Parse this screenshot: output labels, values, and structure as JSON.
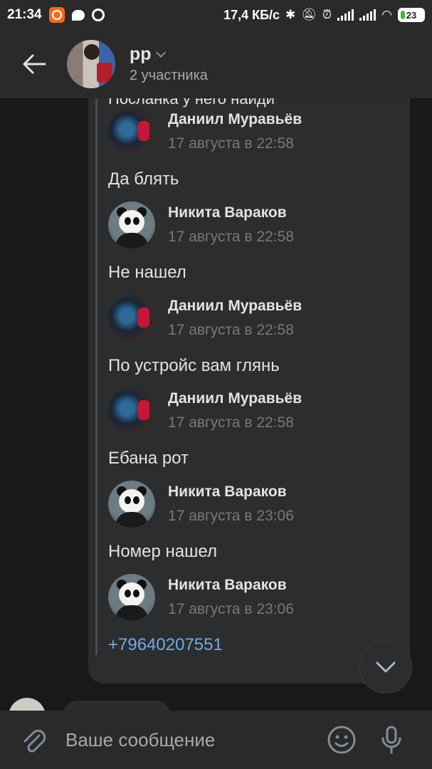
{
  "status_bar": {
    "time": "21:34",
    "net_speed": "17,4 КБ/с",
    "battery": "23",
    "icons": [
      "camera-app-icon",
      "message-icon",
      "alarm-ring-icon",
      "bluetooth-icon",
      "mute-icon",
      "alarm-clock-icon",
      "signal-icon",
      "signal-icon",
      "wifi-icon",
      "battery-icon"
    ]
  },
  "header": {
    "title": "pp",
    "subtitle": "2 участника"
  },
  "forwarded": {
    "cut_text": "Посланка у него найди",
    "items": [
      {
        "author": "Даниил Муравьёв",
        "time": "17 августа в 22:58",
        "text": "Да блять",
        "avatar": "daniil"
      },
      {
        "author": "Никита Вараков",
        "time": "17 августа в 22:58",
        "text": "Не нашел",
        "avatar": "panda"
      },
      {
        "author": "Даниил Муравьёв",
        "time": "17 августа в 22:58",
        "text": "По устройс вам глянь",
        "avatar": "daniil"
      },
      {
        "author": "Даниил Муравьёв",
        "time": "17 августа в 22:58",
        "text": "Ебана рот",
        "avatar": "daniil"
      },
      {
        "author": "Никита Вараков",
        "time": "17 августа в 23:06",
        "text": "Номер нашел",
        "avatar": "panda"
      },
      {
        "author": "Никита Вараков",
        "time": "17 августа в 23:06",
        "text": "+79640207551",
        "avatar": "panda"
      }
    ]
  },
  "composer": {
    "placeholder": "Ваше сообщение"
  },
  "colors": {
    "background": "#19191a",
    "bar": "#2a2a2b",
    "bubble": "#2c2d2e",
    "link": "#71aaeb"
  }
}
